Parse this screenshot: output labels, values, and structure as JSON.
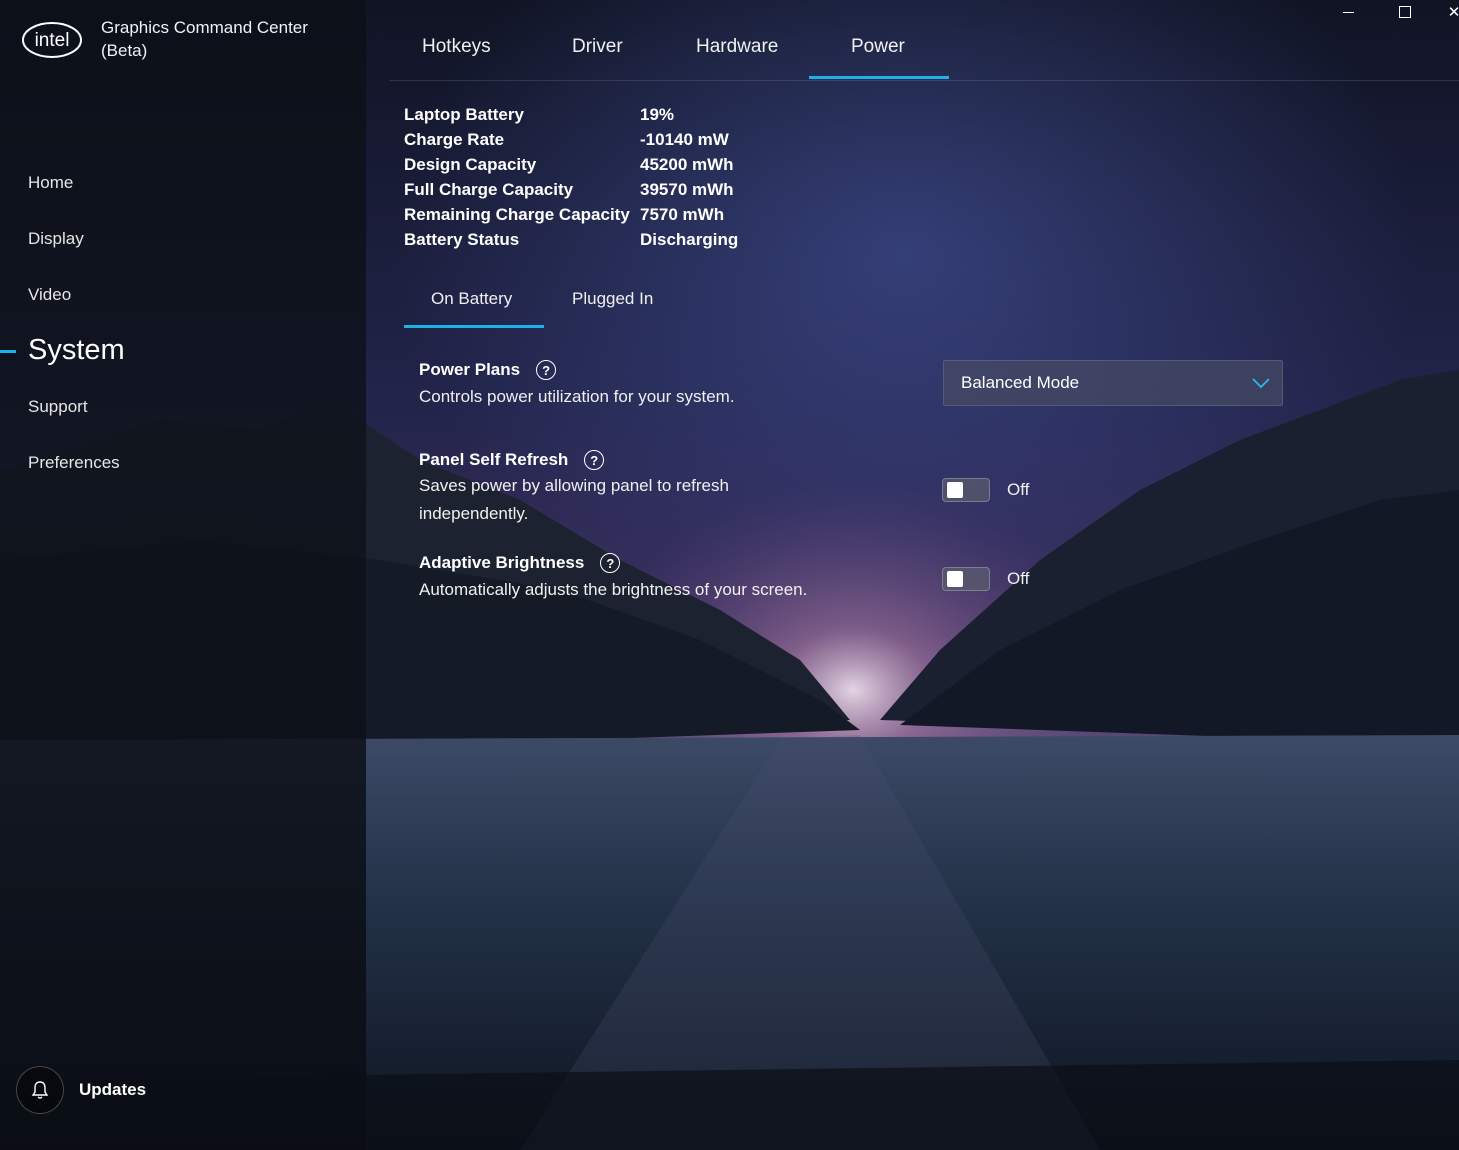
{
  "app": {
    "logo_text": "intel",
    "title": "Graphics Command Center",
    "subtitle": "(Beta)"
  },
  "window_controls": {
    "minimize_icon": "minimize-icon",
    "maximize_icon": "maximize-icon",
    "close_glyph": "✕"
  },
  "sidebar": {
    "items": [
      {
        "label": "Home"
      },
      {
        "label": "Display"
      },
      {
        "label": "Video"
      },
      {
        "label": "System",
        "active": true
      },
      {
        "label": "Support"
      },
      {
        "label": "Preferences"
      }
    ],
    "updates_label": "Updates",
    "accent": "#1fb0e8"
  },
  "top_tabs": [
    {
      "label": "Hotkeys"
    },
    {
      "label": "Driver"
    },
    {
      "label": "Hardware"
    },
    {
      "label": "Power",
      "active": true
    }
  ],
  "battery": [
    {
      "label": "Laptop Battery",
      "value": "19%"
    },
    {
      "label": "Charge Rate",
      "value": "-10140 mW"
    },
    {
      "label": "Design Capacity",
      "value": "45200 mWh"
    },
    {
      "label": "Full Charge Capacity",
      "value": "39570 mWh"
    },
    {
      "label": "Remaining Charge Capacity",
      "value": "7570 mWh"
    },
    {
      "label": "Battery Status",
      "value": "Discharging"
    }
  ],
  "sub_tabs": [
    {
      "label": "On Battery",
      "active": true
    },
    {
      "label": "Plugged In"
    }
  ],
  "settings": {
    "power_plans": {
      "title": "Power Plans",
      "description": "Controls power utilization for your system.",
      "selected": "Balanced Mode"
    },
    "panel_self_refresh": {
      "title": "Panel Self Refresh",
      "description_line1": "Saves power by allowing panel to refresh",
      "description_line2": "independently.",
      "state": "Off"
    },
    "adaptive_brightness": {
      "title": "Adaptive Brightness",
      "description": "Automatically adjusts the brightness of your screen.",
      "state": "Off"
    },
    "help_glyph": "?"
  }
}
